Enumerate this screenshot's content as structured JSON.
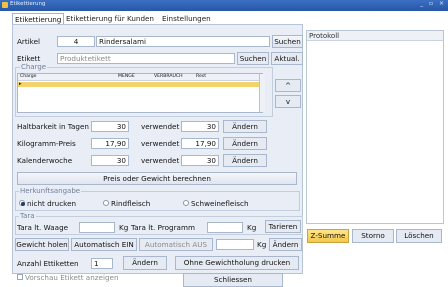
{
  "window": {
    "title": "Etikettierung",
    "controls": "_ ▫ ×"
  },
  "tabs": [
    {
      "label": "Etikettierung"
    },
    {
      "label": "Etikettierung für Kunden"
    },
    {
      "label": "Einstellungen"
    }
  ],
  "artikel": {
    "label": "Artikel",
    "number": "4",
    "name": "Rindersalami",
    "search_btn": "Suchen"
  },
  "etikett": {
    "label": "Etikett",
    "value": "Produktetikett",
    "search_btn": "Suchen",
    "update_btn": "Aktual."
  },
  "charge": {
    "group_title": "Charge",
    "columns": [
      "Charge",
      "MENGE",
      "VERBRAUCH",
      "Rest"
    ],
    "up_btn": "^",
    "down_btn": "v"
  },
  "rows": [
    {
      "label": "Haltbarkeit in Tagen",
      "value": "30",
      "used_label": "verwendet",
      "used": "30",
      "btn": "Ändern"
    },
    {
      "label": "Kilogramm-Preis",
      "value": "17,90",
      "used_label": "verwendet",
      "used": "17,90",
      "btn": "Ändern"
    },
    {
      "label": "Kalenderwoche",
      "value": "30",
      "used_label": "verwendet",
      "used": "30",
      "btn": "Ändern"
    }
  ],
  "calc_btn": "Preis oder Gewicht berechnen",
  "herkunft": {
    "title": "Herkunftsangabe",
    "options": [
      "nicht drucken",
      "Rindfleisch",
      "Schweinefleisch"
    ],
    "selected": "nicht drucken"
  },
  "tara": {
    "title": "Tara",
    "waage_label": "Tara lt. Waage",
    "waage_unit": "Kg",
    "prog_label": "Tara lt. Programm",
    "prog_unit": "Kg",
    "tare_btn": "Tarieren"
  },
  "weight": {
    "get_btn": "Gewicht holen",
    "auto_on_btn": "Automatisch EIN",
    "auto_off_btn": "Automatisch AUS",
    "unit": "Kg",
    "change_btn": "Ändern"
  },
  "count": {
    "label": "Anzahl Ettiketten",
    "value": "1",
    "change_btn": "Ändern",
    "print_btn": "Ohne Gewichtholung drucken",
    "preview_label": "Vorschau Etikett anzeigen",
    "close_btn": "Schliessen"
  },
  "protokoll": {
    "title": "Protokoll"
  },
  "bottom": {
    "zsum_btn": "Z-Summe",
    "storno_btn": "Storno",
    "clear_btn": "Löschen"
  }
}
